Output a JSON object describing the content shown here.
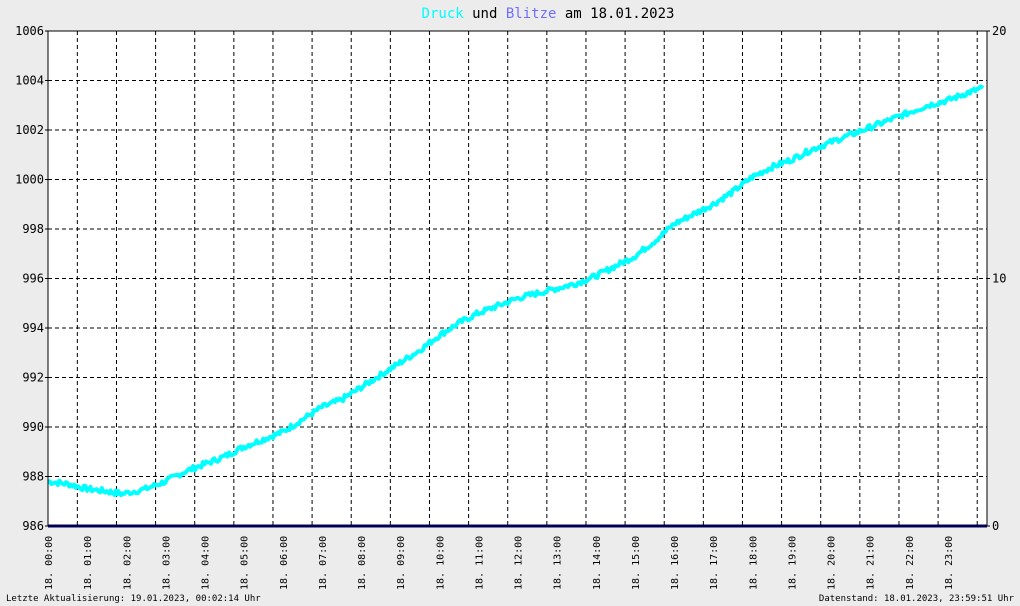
{
  "chart_data": {
    "type": "line",
    "title": {
      "part1": "Druck",
      "part2": " und ",
      "part3": "Blitze",
      "part4": " am 18.01.2023"
    },
    "colors": {
      "pressure": "#00ffff",
      "lightning": "#000080",
      "title_part1": "#00ffff",
      "title_part3": "#7070ff",
      "background": "#ffffff",
      "grid": "#000000"
    },
    "y_left": {
      "min": 986,
      "max": 1006,
      "step": 2,
      "ticks": [
        "986",
        "988",
        "990",
        "992",
        "994",
        "996",
        "998",
        "1000",
        "1002",
        "1004",
        "1006"
      ]
    },
    "y_right": {
      "min": 0,
      "max": 20,
      "ticks": [
        "0",
        "10",
        "20"
      ]
    },
    "x_range_hours": [
      0,
      24
    ],
    "x_ticks": [
      "18. 00:00",
      "18. 01:00",
      "18. 02:00",
      "18. 03:00",
      "18. 04:00",
      "18. 05:00",
      "18. 06:00",
      "18. 07:00",
      "18. 08:00",
      "18. 09:00",
      "18. 10:00",
      "18. 11:00",
      "18. 12:00",
      "18. 13:00",
      "18. 14:00",
      "18. 15:00",
      "18. 16:00",
      "18. 17:00",
      "18. 18:00",
      "18. 19:00",
      "18. 20:00",
      "18. 21:00",
      "18. 22:00",
      "18. 23:00"
    ],
    "grid": true,
    "series": [
      {
        "x": [
          0,
          0.5,
          1,
          1.5,
          1.9,
          2.5,
          3,
          3.5,
          4,
          4.5,
          5,
          5.5,
          6,
          6.5,
          7,
          7.5,
          8,
          8.5,
          9,
          9.5,
          10,
          10.5,
          11,
          11.5,
          12,
          12.5,
          13,
          13.5,
          14,
          14.5,
          15,
          15.5,
          16,
          16.5,
          17,
          17.5,
          18,
          18.5,
          19,
          19.5,
          20,
          20.5,
          21,
          21.5,
          22,
          22.5,
          23,
          23.5,
          23.9
        ],
        "values": [
          987.8,
          987.7,
          987.5,
          987.4,
          987.3,
          987.5,
          987.8,
          988.2,
          988.5,
          988.8,
          989.2,
          989.5,
          989.8,
          990.3,
          990.8,
          991.1,
          991.6,
          992.1,
          992.6,
          993.1,
          993.7,
          994.2,
          994.6,
          994.9,
          995.2,
          995.4,
          995.6,
          995.8,
          996.1,
          996.5,
          996.9,
          997.5,
          998.2,
          998.6,
          999.0,
          999.5,
          1000.1,
          1000.5,
          1000.8,
          1001.2,
          1001.5,
          1001.8,
          1002.1,
          1002.4,
          1002.7,
          1003.0,
          1003.2,
          1003.5,
          1003.7
        ]
      },
      {
        "x": [
          0,
          24
        ],
        "values": [
          0,
          0
        ]
      }
    ]
  },
  "footer": {
    "left": "Letzte Aktualisierung: 19.01.2023, 00:02:14 Uhr",
    "right": "Datenstand: 18.01.2023, 23:59:51 Uhr"
  }
}
